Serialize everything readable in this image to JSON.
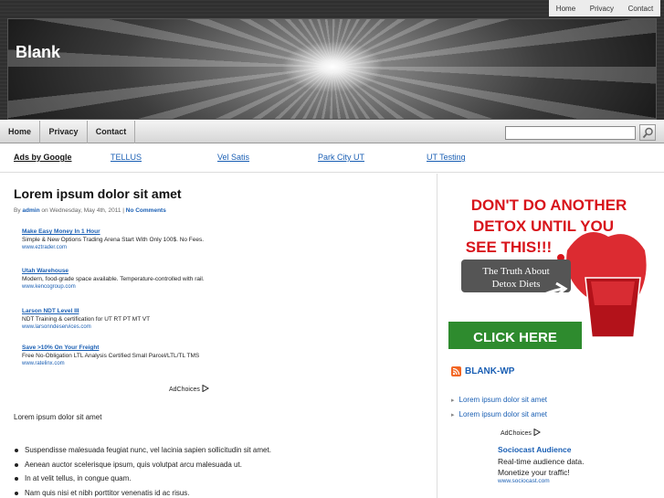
{
  "top_links": [
    "Home",
    "Privacy",
    "Contact"
  ],
  "site": {
    "title": "Blank"
  },
  "nav": {
    "items": [
      "Home",
      "Privacy",
      "Contact"
    ]
  },
  "search": {
    "placeholder": ""
  },
  "ads_bar": {
    "label": "Ads by Google",
    "links": [
      "TELLUS",
      "Vel Satis",
      "Park City UT",
      "UT Testing"
    ]
  },
  "post": {
    "title": "Lorem ipsum dolor sit amet",
    "meta_prefix": "By",
    "author": "admin",
    "date_text": "on Wednesday, May 4th, 2011 |",
    "comments": "No Comments",
    "paragraph": "Lorem ipsum dolor sit amet",
    "bullets": [
      "Suspendisse malesuada feugiat nunc, vel lacinia sapien sollicitudin sit amet.",
      "Aenean auctor scelerisque ipsum, quis volutpat arcu malesuada ut.",
      "In at velit tellus, in congue quam.",
      "Nam quis nisi et nibh porttitor venenatis id ac risus."
    ]
  },
  "text_ads": [
    {
      "title": "Make Easy Money In 1 Hour",
      "desc": "Simple & New Options Trading Arena Start With Only 100$. No Fees.",
      "url": "www.eztrader.com"
    },
    {
      "title": "Utah Warehouse",
      "desc": "Modern, food-grade space available. Temperature-controlled with rail.",
      "url": "www.kencogroup.com"
    },
    {
      "title": "Larson NDT Level III",
      "desc": "NDT Training & certification for UT RT PT MT VT",
      "url": "www.larsonndeservices.com"
    },
    {
      "title": "Save >10% On Your Freight",
      "desc": "Free No-Obligation LTL Analysis Certified Small Parcel/LTL/TL TMS",
      "url": "www.ratelinx.com"
    }
  ],
  "adchoices": "AdChoices",
  "banner": {
    "line1": "DON'T DO ANOTHER",
    "line2": "DETOX UNTIL YOU",
    "line3": "SEE THIS!!!",
    "sub1": "The Truth About",
    "sub2": "Detox Diets",
    "cta": "CLICK HERE",
    "colors": {
      "red": "#d8141b",
      "green": "#2e8b2e",
      "dark": "#555555"
    }
  },
  "sidebar": {
    "feed_title": "BLANK-WP",
    "items": [
      "Lorem ipsum dolor sit amet",
      "Lorem ipsum dolor sit amet"
    ],
    "ad": {
      "title": "Sociocast Audience",
      "line1": "Real-time audience data.",
      "line2": "Monetize your traffic!",
      "url": "www.sociocast.com"
    }
  },
  "colors": {
    "link": "#1a5fb4",
    "accent_rss": "#f26522"
  }
}
